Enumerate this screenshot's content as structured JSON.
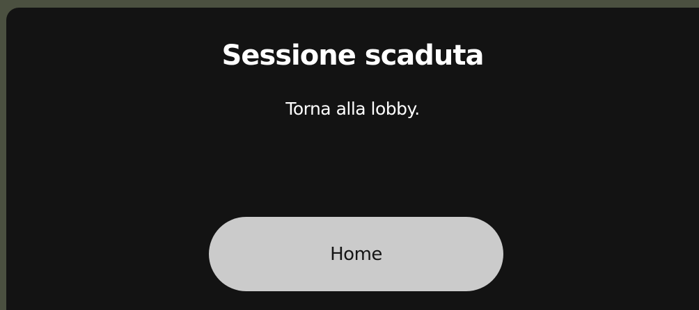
{
  "dialog": {
    "title": "Sessione scaduta",
    "message": "Torna alla lobby.",
    "home_label": "Home"
  },
  "colors": {
    "dialog_background": "#131313",
    "button_background": "#cbcbcb",
    "title_text": "#ffffff",
    "button_text": "#151515"
  }
}
